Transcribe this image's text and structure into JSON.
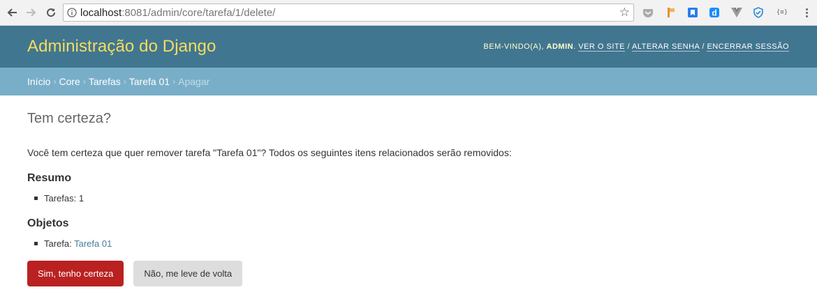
{
  "browser": {
    "url_host": "localhost",
    "url_rest": ":8081/admin/core/tarefa/1/delete/",
    "extensions": [
      "pocket-icon",
      "bookmark-flag-icon",
      "bookmark-icon",
      "d-app-icon",
      "vue-devtools-icon",
      "shield-icon",
      "json-viewer-icon"
    ],
    "json_badge": "{≡}"
  },
  "header": {
    "branding": "Administração do Django",
    "welcome": "Bem-vindo(a), ",
    "username": "admin",
    "dot": ". ",
    "view_site": "Ver o site",
    "slash1": " / ",
    "change_password": "Alterar senha",
    "slash2": " / ",
    "logout": "Encerrar sessão"
  },
  "breadcrumbs": {
    "home": "Início",
    "app": "Core",
    "model": "Tarefas",
    "object": "Tarefa 01",
    "current": "Apagar",
    "separator": "›"
  },
  "main": {
    "title": "Tem certeza?",
    "message": "Você tem certeza que quer remover tarefa \"Tarefa 01\"? Todos os seguintes itens relacionados serão removidos:",
    "summary_heading": "Resumo",
    "summary_item": "Tarefas: 1",
    "objects_heading": "Objetos",
    "object_prefix": "Tarefa: ",
    "object_link": "Tarefa 01",
    "confirm_button": "Sim, tenho certeza",
    "cancel_button": "Não, me leve de volta"
  },
  "colors": {
    "header_bg": "#417690",
    "breadcrumbs_bg": "#79aec8",
    "branding": "#f5dd5d",
    "danger": "#ba2121",
    "link": "#447e9b"
  }
}
